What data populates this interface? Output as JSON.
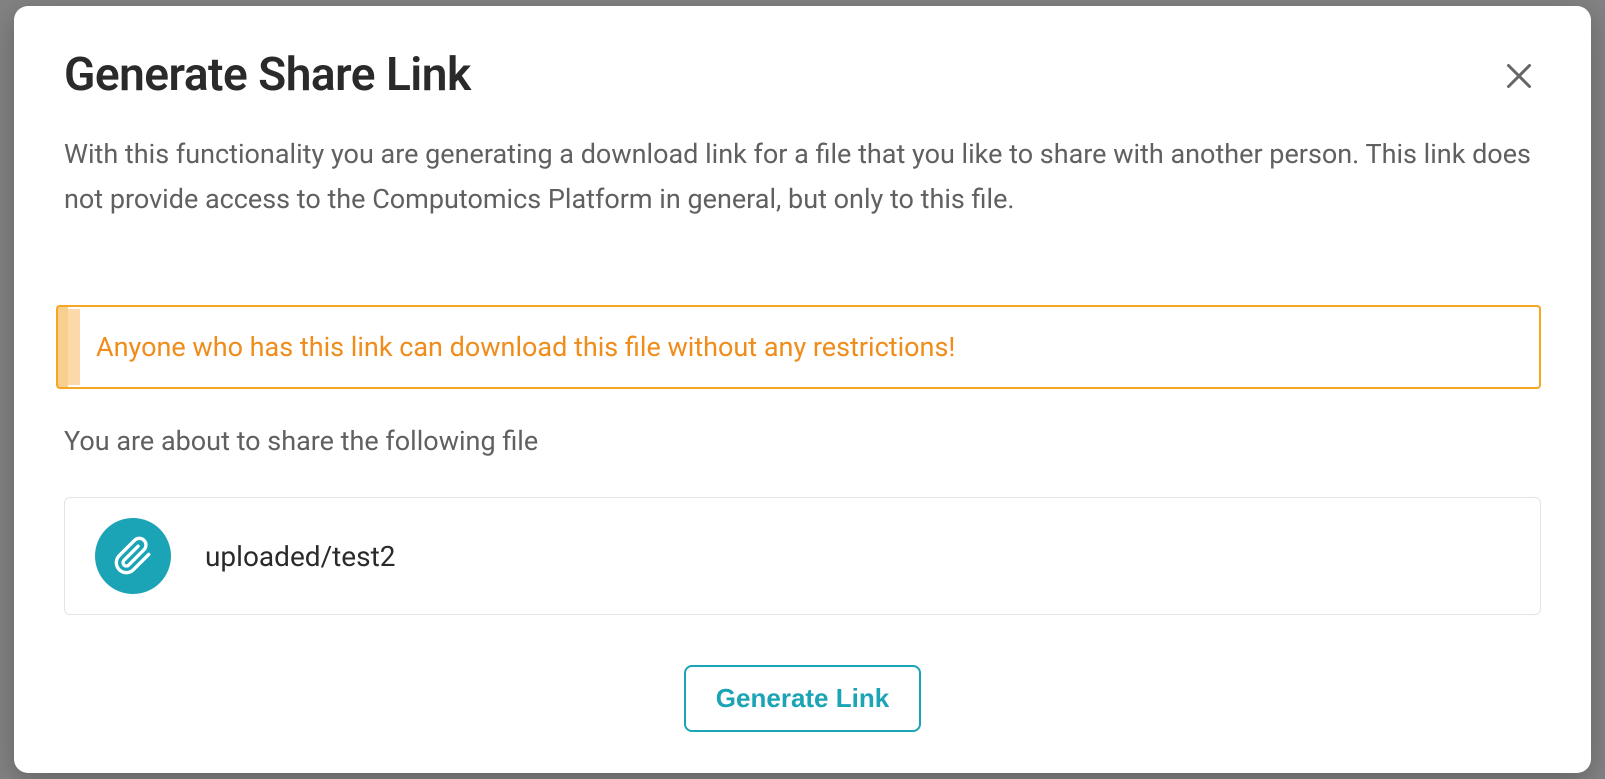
{
  "modal": {
    "title": "Generate Share Link",
    "description": "With this functionality you are generating a download link for a file that you like to share with another person. This link does not provide access to the Computomics Platform in general, but only to this file.",
    "warning": "Anyone who has this link can download this file without any restrictions!",
    "subheading": "You are about to share the following file",
    "file_path": "uploaded/test2",
    "generate_button_label": "Generate Link"
  },
  "colors": {
    "accent": "#1BA4B6",
    "warning_border": "#F5A623",
    "warning_text": "#F08C1A"
  }
}
